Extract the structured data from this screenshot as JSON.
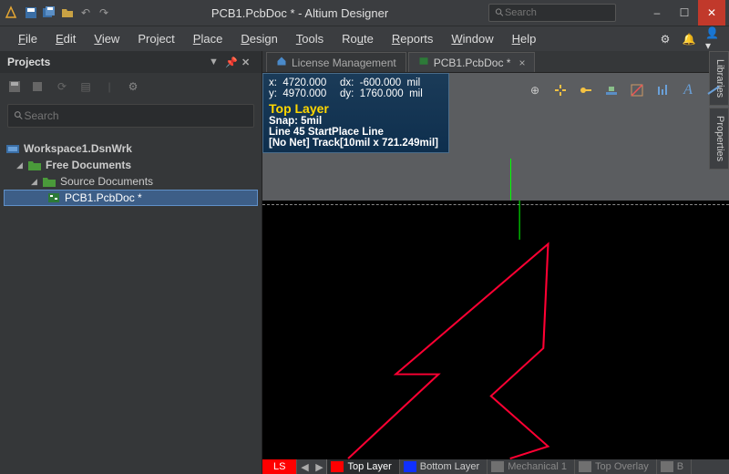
{
  "window": {
    "title": "PCB1.PcbDoc * - Altium Designer"
  },
  "search": {
    "placeholder": "Search"
  },
  "menu": {
    "file": "File",
    "edit": "Edit",
    "view": "View",
    "project": "Project",
    "place": "Place",
    "design": "Design",
    "tools": "Tools",
    "route": "Route",
    "reports": "Reports",
    "window": "Window",
    "help": "Help"
  },
  "panel": {
    "title": "Projects",
    "search_ph": "Search"
  },
  "tree": {
    "workspace": "Workspace1.DsnWrk",
    "free_docs": "Free Documents",
    "source_docs": "Source Documents",
    "pcb_doc": "PCB1.PcbDoc *"
  },
  "doctabs": {
    "license": "License Management",
    "pcb": "PCB1.PcbDoc *"
  },
  "hud": {
    "x_label": "x:",
    "x_val": "4720.000",
    "dx_label": "dx:",
    "dx_val": "-600.000",
    "y_label": "y:",
    "y_val": "4970.000",
    "dy_label": "dy:",
    "dy_val": "1760.000",
    "unit": "mil",
    "layer": "Top Layer",
    "snap": "Snap: 5mil",
    "line": "Line 45 StartPlace Line",
    "track": "[No Net] Track[10mil x 721.249mil]"
  },
  "layers": {
    "ls": "LS",
    "top": "Top Layer",
    "bottom": "Bottom Layer",
    "mech1": "Mechanical 1",
    "overlay": "Top Overlay",
    "bot_ov": "B"
  },
  "rtabs": {
    "lib": "Libraries",
    "prop": "Properties"
  },
  "colors": {
    "top": "#ff0000",
    "bottom": "#1030ff",
    "mech": "#808080",
    "overlay": "#808080",
    "ls_bg": "#ff0000"
  }
}
